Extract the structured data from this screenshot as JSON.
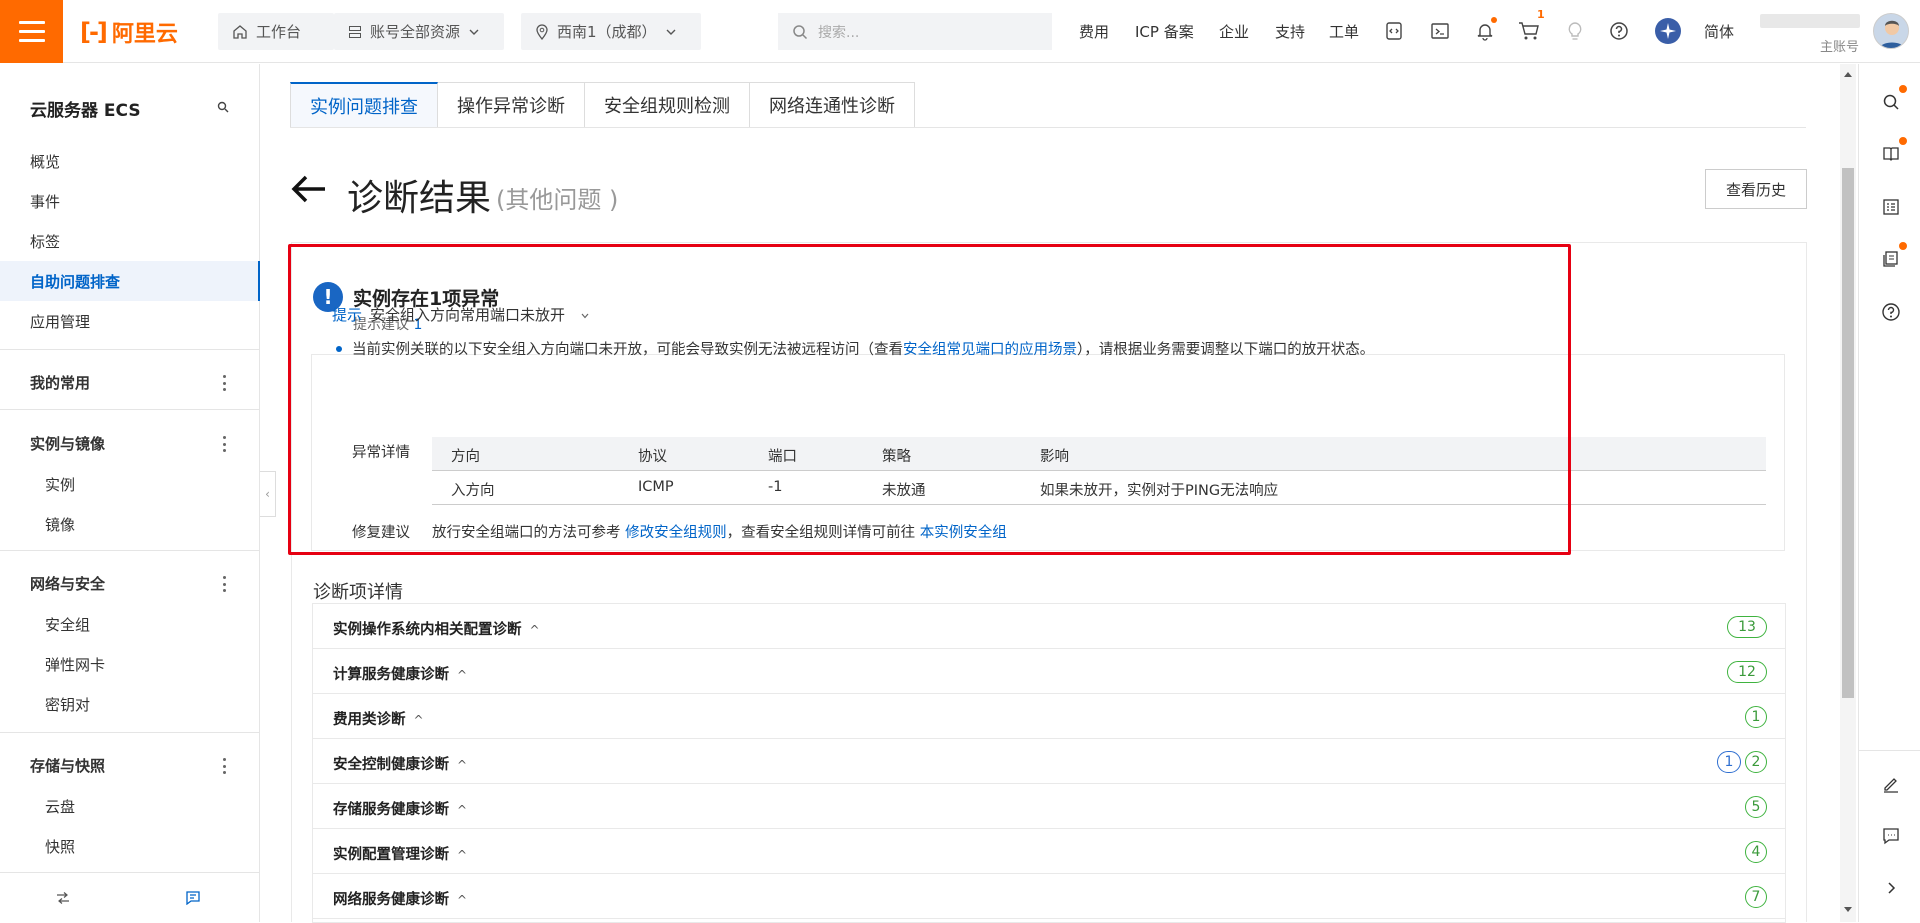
{
  "topbar": {
    "logo_text": "阿里云",
    "workbench": "工作台",
    "resources": "账号全部资源",
    "region": "西南1（成都）",
    "search_placeholder": "搜索...",
    "nav": [
      "费用",
      "ICP 备案",
      "企业",
      "支持",
      "工单"
    ],
    "cart_count": "1",
    "lang": "简体",
    "account_role": "主账号",
    "accent_color": "#ff6a00"
  },
  "sidebar": {
    "title": "云服务器 ECS",
    "top_items": [
      "概览",
      "事件",
      "标签",
      "自助问题排查",
      "应用管理"
    ],
    "active_item": "自助问题排查",
    "groups": [
      {
        "label": "我的常用",
        "items": []
      },
      {
        "label": "实例与镜像",
        "items": [
          "实例",
          "镜像"
        ]
      },
      {
        "label": "网络与安全",
        "items": [
          "安全组",
          "弹性网卡",
          "密钥对"
        ]
      },
      {
        "label": "存储与快照",
        "items": [
          "云盘",
          "快照"
        ]
      }
    ]
  },
  "tabs": [
    "实例问题排查",
    "操作异常诊断",
    "安全组规则检测",
    "网络连通性诊断"
  ],
  "page": {
    "title": "诊断结果",
    "subtitle": "(其他问题 )",
    "history_button": "查看历史"
  },
  "abnormal": {
    "title": "实例存在1项异常",
    "hint_label": "提示建议",
    "hint_count": "1",
    "tip_label": "提示",
    "tip_title": "安全组入方向常用端口未放开",
    "desc_prefix": "当前实例关联的以下安全组入方向端口未开放，可能会导致实例无法被远程访问（查看",
    "desc_link": "安全组常见端口的应用场景",
    "desc_suffix": "），请根据业务需要调整以下端口的放开状态。",
    "detail_label": "异常详情",
    "columns": [
      "方向",
      "协议",
      "端口",
      "策略",
      "影响"
    ],
    "rows": [
      [
        "入方向",
        "ICMP",
        "-1",
        "未放通",
        "如果未放开，实例对于PING无法响应"
      ]
    ],
    "fix_label": "修复建议",
    "fix_prefix": "放行安全组端口的方法可参考",
    "fix_link1": "修改安全组规则",
    "fix_middle": "，查看安全组规则详情可前往",
    "fix_link2": "本实例安全组"
  },
  "diagnosis": {
    "title": "诊断项详情",
    "items": [
      {
        "name": "实例操作系统内相关配置诊断",
        "counts": [
          "13"
        ],
        "expanded": true
      },
      {
        "name": "计算服务健康诊断",
        "counts": [
          "12"
        ],
        "expanded": false
      },
      {
        "name": "费用类诊断",
        "counts": [
          "1"
        ],
        "expanded": false
      },
      {
        "name": "安全控制健康诊断",
        "counts": [
          "1",
          "2"
        ],
        "expanded": false
      },
      {
        "name": "存储服务健康诊断",
        "counts": [
          "5"
        ],
        "expanded": false
      },
      {
        "name": "实例配置管理诊断",
        "counts": [
          "4"
        ],
        "expanded": false
      },
      {
        "name": "网络服务健康诊断",
        "counts": [
          "7"
        ],
        "expanded": false
      }
    ]
  }
}
